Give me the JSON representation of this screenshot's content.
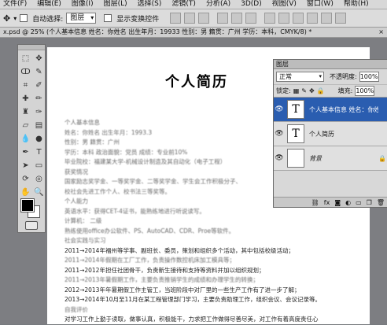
{
  "menu": [
    "文件(F)",
    "编辑(E)",
    "图像(I)",
    "图层(L)",
    "选择(S)",
    "滤镜(T)",
    "分析(A)",
    "3D(D)",
    "视图(V)",
    "窗口(W)",
    "帮助(H)"
  ],
  "options": {
    "auto_select_label": "自动选择:",
    "auto_select_value": "图层",
    "show_transform_label": "显示变换控件"
  },
  "doc_tab": {
    "text": "x.psd @ 25% (个人基本信息  姓名：你姓名  出生年月：19933        性别：男    籍贯：广州 学历：本科，CMYK/8) *",
    "close": "×"
  },
  "document": {
    "title": "个人简历",
    "lines": [
      {
        "text": "个人基本信息",
        "blur": true
      },
      {
        "text": "姓名：你姓名   出生年月：1993.3",
        "blur": true
      },
      {
        "text": "性别：男    籍贯：广州",
        "blur": true
      },
      {
        "text": "学历：本科   政治面貌：党员   成绩：专业前10%",
        "blur": true
      },
      {
        "text": "毕业院校：福建某大学-机械设计制造及其自动化（电子工程）",
        "blur": true
      },
      {
        "text": "获奖情况",
        "blur": true
      },
      {
        "text": "国家励志奖学金、一等奖学金、二等奖学金、学生会工作积极分子、",
        "blur": true
      },
      {
        "text": "校社会先进工作个人、校书法三等奖等。",
        "blur": true
      },
      {
        "text": "个人能力",
        "blur": true
      },
      {
        "text": "英语水平：获得CET-4证书，能熟练地进行听说读写。",
        "blur": true
      },
      {
        "text": "计算机：   二级",
        "blur": true
      },
      {
        "text": "熟练使用office办公软件、PS、AutoCAD、CDR、Proe等软件。",
        "blur": true
      },
      {
        "text": "社会实践与实习",
        "blur": true
      },
      {
        "text": "2011→2014年福州等学事、副班长、委员，策划和组织多个活动，其中包括校级活动；",
        "blur": false
      },
      {
        "text": "2011→2014年假期在工厂工作，负责操作数控机床加工模具等；",
        "blur": true
      },
      {
        "text": "2011→2012年担任社团骨干，负责新生接待和支持等资料并加以组织规划；",
        "blur": false
      },
      {
        "text": "2011→2013年暑假期工作，主要负责推销学生的成绩和办理学生的转换；",
        "blur": true
      },
      {
        "text": "2012→2013年年暑期假工作主管工，当班阶段中对厂里的一些生产工作有了进一步了解；",
        "blur": false
      },
      {
        "text": "2013→2014年10月至11月在某工程管理部门学习，主要负责助理工作，组织会议、会议记录等。",
        "blur": false
      },
      {
        "text": "自我评价",
        "blur": true
      },
      {
        "text": "对学习工作上勤于读取，做事认真，积极能干，力求把工作做得尽善尽美，对工作有着高度责任心",
        "blur": false
      }
    ]
  },
  "layers_panel": {
    "title": "图层",
    "blend_mode": "正常",
    "opacity_label": "不透明度:",
    "opacity_value": "100%",
    "lock_label": "锁定:",
    "fill_label": "填充:",
    "fill_value": "100%",
    "layers": [
      {
        "name": "个人基本信息  姓名：你姓...",
        "thumb": "T",
        "active": true,
        "italic": false
      },
      {
        "name": "个人简历",
        "thumb": "T",
        "active": false,
        "italic": false
      },
      {
        "name": "背景",
        "thumb": "",
        "active": false,
        "italic": true
      }
    ]
  }
}
